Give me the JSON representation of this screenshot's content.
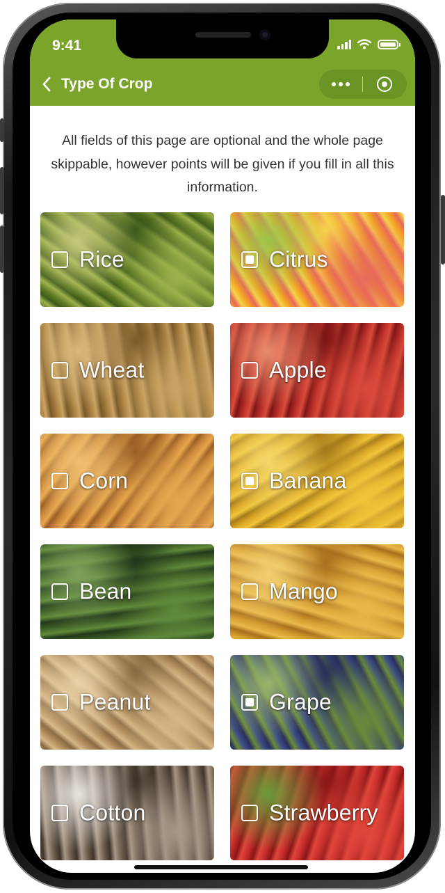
{
  "status": {
    "time": "9:41"
  },
  "header": {
    "title": "Type Of Crop"
  },
  "intro": "All fields of this page are optional and the whole page skippable, however points will be given if you fill in all this information.",
  "crops": [
    {
      "label": "Rice",
      "checked": false,
      "colors": [
        "#5f7a23",
        "#9bb14c",
        "#3e5a1a",
        "#c5c77a"
      ]
    },
    {
      "label": "Citrus",
      "checked": true,
      "colors": [
        "#f3a51f",
        "#e8695a",
        "#f6d24c",
        "#9cc24a"
      ]
    },
    {
      "label": "Wheat",
      "checked": false,
      "colors": [
        "#a37a3c",
        "#c9a264",
        "#7a5a28",
        "#d9b87c"
      ]
    },
    {
      "label": "Apple",
      "checked": false,
      "colors": [
        "#b32a25",
        "#d94a3b",
        "#7c1615",
        "#e98a6a"
      ]
    },
    {
      "label": "Corn",
      "checked": false,
      "colors": [
        "#c9853a",
        "#e6a64e",
        "#9a5e25",
        "#f0c070"
      ]
    },
    {
      "label": "Banana",
      "checked": true,
      "colors": [
        "#d9a524",
        "#f0c43a",
        "#a67a1a",
        "#f5d86a"
      ]
    },
    {
      "label": "Bean",
      "checked": false,
      "colors": [
        "#3b5a24",
        "#5f8a3a",
        "#22381a",
        "#7ea25a"
      ]
    },
    {
      "label": "Mango",
      "checked": false,
      "colors": [
        "#d39a2c",
        "#eab84a",
        "#a86e1c",
        "#f2cf72"
      ]
    },
    {
      "label": "Peanut",
      "checked": false,
      "colors": [
        "#b08a5a",
        "#d6b686",
        "#8a6a42",
        "#e8d2a8"
      ]
    },
    {
      "label": "Grape",
      "checked": true,
      "colors": [
        "#3a4a8a",
        "#6a8a3a",
        "#2a2f5a",
        "#9ab46a"
      ]
    },
    {
      "label": "Cotton",
      "checked": false,
      "colors": [
        "#6a5a4a",
        "#a89888",
        "#3e342a",
        "#e6e2dc"
      ]
    },
    {
      "label": "Strawberry",
      "checked": false,
      "colors": [
        "#c22a2a",
        "#e0463a",
        "#8a1616",
        "#6a9a3a"
      ]
    }
  ]
}
